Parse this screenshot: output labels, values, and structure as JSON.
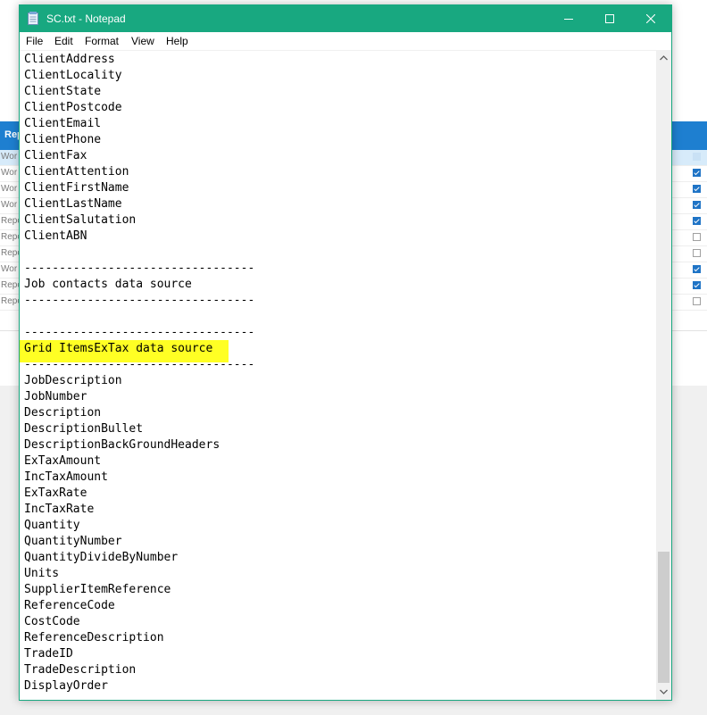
{
  "background_app": {
    "header_label": "Rep",
    "rows": [
      {
        "label": "Wor",
        "checked": true,
        "selected": true
      },
      {
        "label": "Wor",
        "checked": true,
        "selected": false
      },
      {
        "label": "Wor",
        "checked": true,
        "selected": false
      },
      {
        "label": "Wor",
        "checked": true,
        "selected": false
      },
      {
        "label": "Repo",
        "checked": true,
        "selected": false
      },
      {
        "label": "Repo",
        "checked": false,
        "selected": false
      },
      {
        "label": "Repo",
        "checked": false,
        "selected": false
      },
      {
        "label": "Wor",
        "checked": true,
        "selected": false
      },
      {
        "label": "Repo",
        "checked": true,
        "selected": false
      },
      {
        "label": "Repo",
        "checked": false,
        "selected": false
      }
    ]
  },
  "window": {
    "title": "SC.txt - Notepad",
    "accent_color": "#18a880",
    "icon": "notepad-icon",
    "controls": [
      "minimize-icon",
      "maximize-icon",
      "close-icon"
    ]
  },
  "menu": [
    "File",
    "Edit",
    "Format",
    "View",
    "Help"
  ],
  "editor": {
    "highlight_color": "#ffff24",
    "highlighted_line": "Grid ItemsExTax data source",
    "lines": [
      "ClientAddress",
      "ClientLocality",
      "ClientState",
      "ClientPostcode",
      "ClientEmail",
      "ClientPhone",
      "ClientFax",
      "ClientAttention",
      "ClientFirstName",
      "ClientLastName",
      "ClientSalutation",
      "ClientABN",
      "",
      "---------------------------------",
      "Job contacts data source",
      "---------------------------------",
      "",
      "---------------------------------",
      "Grid ItemsExTax data source",
      "---------------------------------",
      "JobDescription",
      "JobNumber",
      "Description",
      "DescriptionBullet",
      "DescriptionBackGroundHeaders",
      "ExTaxAmount",
      "IncTaxAmount",
      "ExTaxRate",
      "IncTaxRate",
      "Quantity",
      "QuantityNumber",
      "QuantityDivideByNumber",
      "Units",
      "SupplierItemReference",
      "ReferenceCode",
      "CostCode",
      "ReferenceDescription",
      "TradeID",
      "TradeDescription",
      "DisplayOrder"
    ]
  },
  "scrollbar": {
    "position": 0.87,
    "visible_fraction": 0.21
  }
}
